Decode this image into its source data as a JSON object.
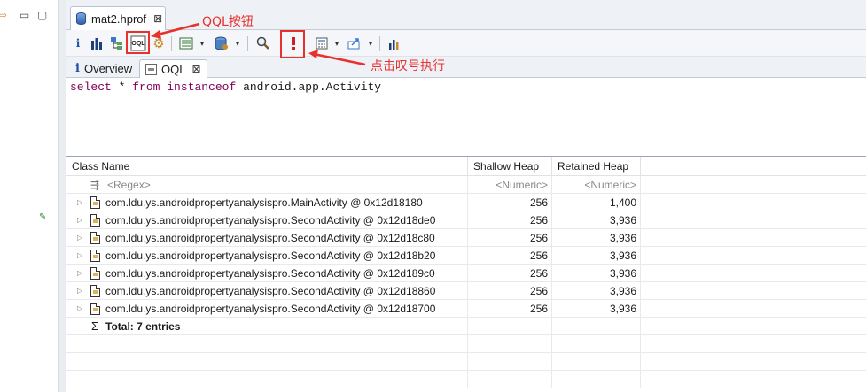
{
  "editor": {
    "tab_title": "mat2.hprof",
    "tab_close": "⊠"
  },
  "toolbar": {
    "oql_button_label": "OQL",
    "dropdown_glyph": "▾"
  },
  "subtabs": [
    {
      "label": "Overview"
    },
    {
      "label": "OQL",
      "close": "⊠"
    }
  ],
  "query": {
    "kw_select": "select",
    "star": " * ",
    "kw_from": "from",
    "kw_instanceof": "instanceof",
    "class_name": " android.app.Activity"
  },
  "table": {
    "columns": [
      "Class Name",
      "Shallow Heap",
      "Retained Heap"
    ],
    "filter": {
      "name": "<Regex>",
      "shallow": "<Numeric>",
      "retained": "<Numeric>"
    },
    "rows": [
      {
        "name": "com.ldu.ys.androidpropertyanalysispro.MainActivity @ 0x12d18180",
        "shallow": "256",
        "retained": "1,400"
      },
      {
        "name": "com.ldu.ys.androidpropertyanalysispro.SecondActivity @ 0x12d18de0",
        "shallow": "256",
        "retained": "3,936"
      },
      {
        "name": "com.ldu.ys.androidpropertyanalysispro.SecondActivity @ 0x12d18c80",
        "shallow": "256",
        "retained": "3,936"
      },
      {
        "name": "com.ldu.ys.androidpropertyanalysispro.SecondActivity @ 0x12d18b20",
        "shallow": "256",
        "retained": "3,936"
      },
      {
        "name": "com.ldu.ys.androidpropertyanalysispro.SecondActivity @ 0x12d189c0",
        "shallow": "256",
        "retained": "3,936"
      },
      {
        "name": "com.ldu.ys.androidpropertyanalysispro.SecondActivity @ 0x12d18860",
        "shallow": "256",
        "retained": "3,936"
      },
      {
        "name": "com.ldu.ys.androidpropertyanalysispro.SecondActivity @ 0x12d18700",
        "shallow": "256",
        "retained": "3,936"
      }
    ],
    "total_label": "Total: 7 entries",
    "sigma": "Σ"
  },
  "annotations": {
    "oql_button": "QQL按钮",
    "execute": "点击叹号执行"
  },
  "colors": {
    "annotation_red": "#e8302c",
    "keyword": "#7f0055"
  }
}
